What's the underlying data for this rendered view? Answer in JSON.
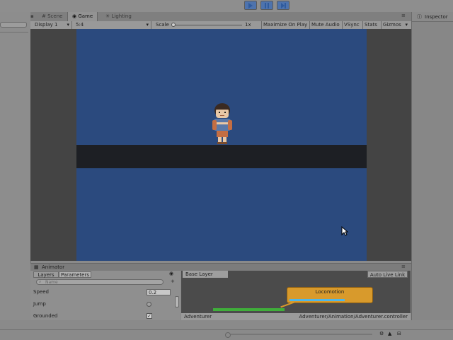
{
  "toolbar": {
    "play_state": "playing"
  },
  "tabs": {
    "scene": "Scene",
    "game": "Game",
    "lighting": "Lighting",
    "inspector": "Inspector"
  },
  "game_toolbar": {
    "display": "Display 1",
    "aspect": "5:4",
    "scale_label": "Scale",
    "scale_value": "1x",
    "maximize": "Maximize On Play",
    "mute": "Mute Audio",
    "vsync": "VSync",
    "stats": "Stats",
    "gizmos": "Gizmos"
  },
  "animator": {
    "title": "Animator",
    "tab_layers": "Layers",
    "tab_parameters": "Parameters",
    "search_placeholder": "Name",
    "base_layer": "Base Layer",
    "auto_live_link": "Auto Live Link",
    "params": [
      {
        "name": "Speed",
        "value": "0.2"
      },
      {
        "name": "Jump",
        "checked": false
      },
      {
        "name": "Grounded",
        "checked": true
      }
    ],
    "state_name": "Locomotion",
    "footer_left": "Adventurer",
    "footer_right": "Adventurer/Animation/Adventurer.controller"
  },
  "colors": {
    "sky": "#2b4a7e",
    "ground": "#1d1f24",
    "state_node": "#d89a2c",
    "transition": "#3fae3a"
  }
}
